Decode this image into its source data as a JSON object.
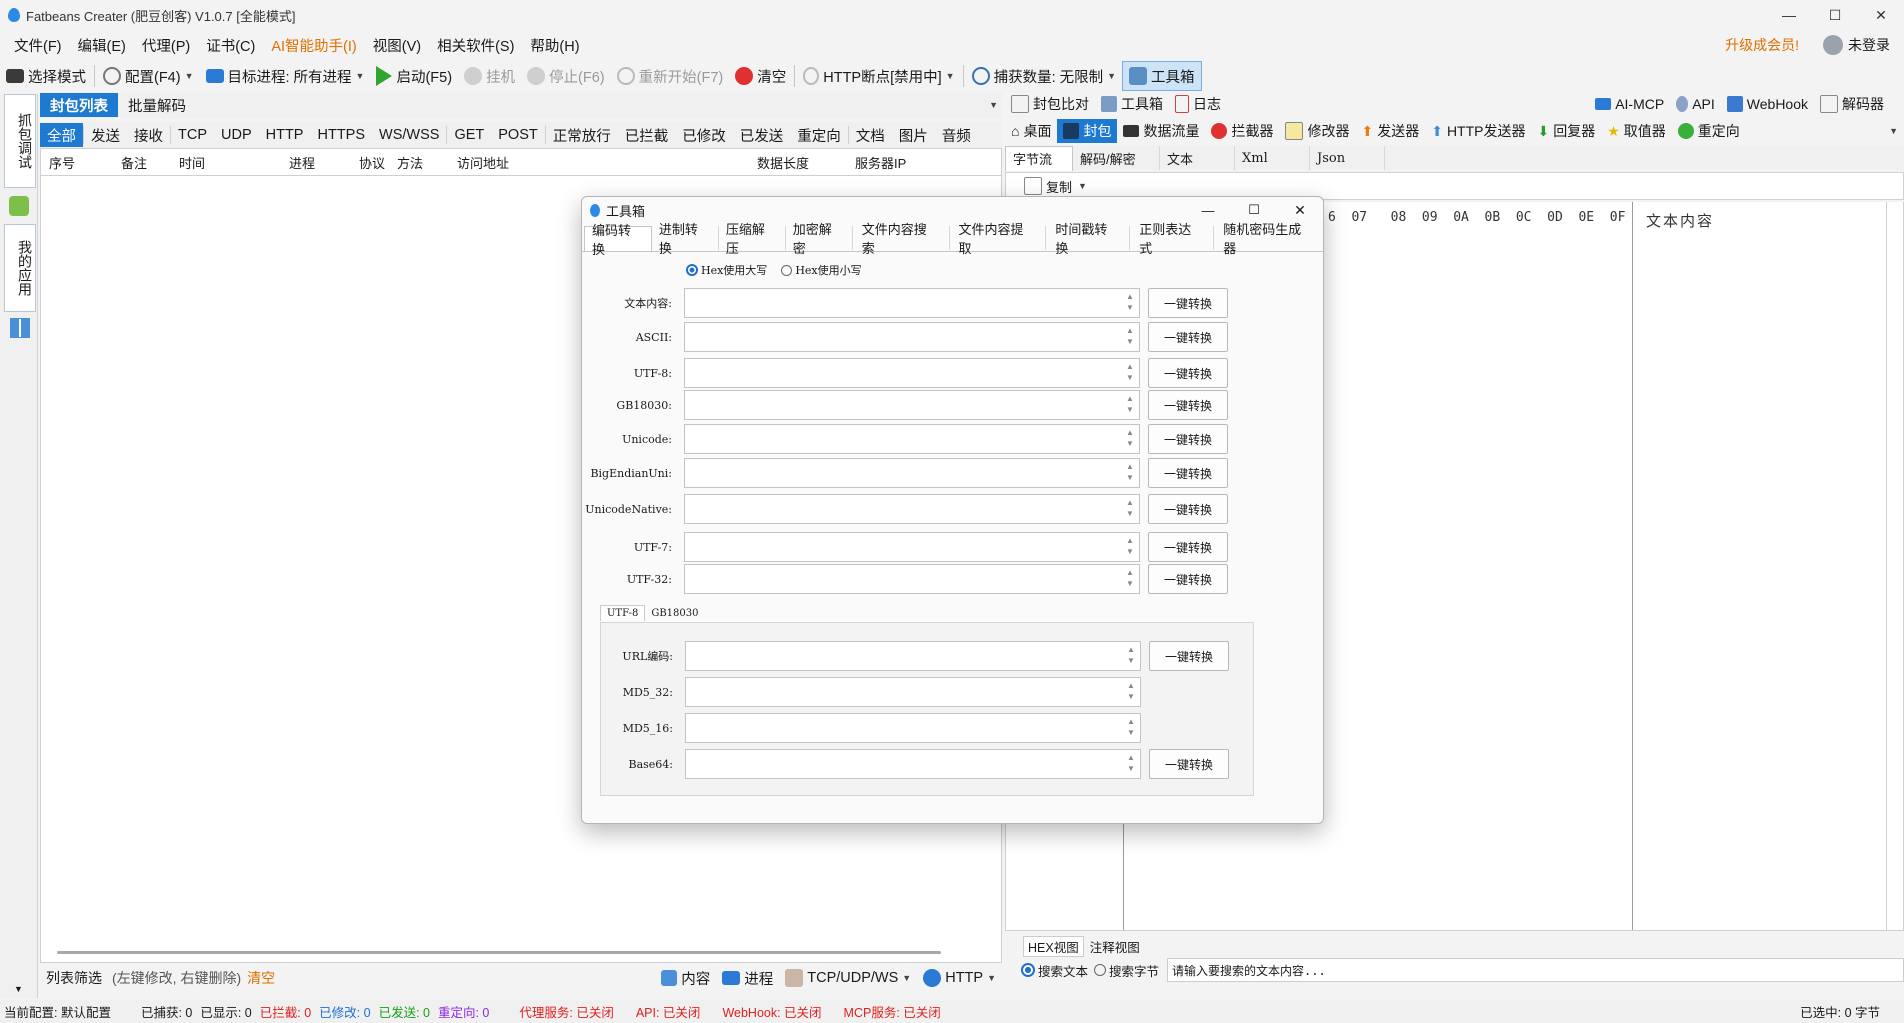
{
  "window": {
    "title": "Fatbeans Creater (肥豆创客) V1.0.7 [全能模式]",
    "min": "—",
    "max": "☐",
    "close": "✕"
  },
  "menu": [
    "文件(F)",
    "编辑(E)",
    "代理(P)",
    "证书(C)",
    "AI智能助手(I)",
    "视图(V)",
    "相关软件(S)",
    "帮助(H)"
  ],
  "menu_right": {
    "upgrade": "升级成会员!",
    "login": "未登录"
  },
  "toolbar": {
    "select_mode": "选择模式",
    "config": "配置(F4)",
    "target_label": "目标进程:",
    "target_value": "所有进程",
    "start": "启动(F5)",
    "hang": "挂机",
    "stop": "停止(F6)",
    "restart": "重新开始(F7)",
    "clear": "清空",
    "http_break": "HTTP断点[禁用中]",
    "capture_label": "捕获数量:",
    "capture_value": "无限制",
    "toolbox": "工具箱"
  },
  "leftstrip": {
    "tab1": "抓包调试",
    "tab2": "我的应用"
  },
  "left": {
    "tabs": [
      "封包列表",
      "批量解码"
    ],
    "filters": [
      "全部",
      "发送",
      "接收",
      "TCP",
      "UDP",
      "HTTP",
      "HTTPS",
      "WS/WSS",
      "GET",
      "POST",
      "正常放行",
      "已拦截",
      "已修改",
      "已发送",
      "重定向",
      "文档",
      "图片",
      "音频"
    ],
    "columns": [
      "序号",
      "备注",
      "时间",
      "进程",
      "协议",
      "方法",
      "访问地址",
      "数据长度",
      "服务器IP"
    ],
    "bottom": {
      "filter_label": "列表筛选",
      "hint": "(左键修改, 右键删除)",
      "clear": "清空",
      "content": "内容",
      "process": "进程",
      "tcp": "TCP/UDP/WS",
      "http": "HTTP"
    }
  },
  "right": {
    "row1": [
      "封包比对",
      "工具箱",
      "日志"
    ],
    "row1_right": [
      "AI-MCP",
      "API",
      "WebHook",
      "解码器"
    ],
    "row2": [
      "桌面",
      "封包",
      "数据流量",
      "拦截器",
      "修改器",
      "发送器",
      "HTTP发送器",
      "回复器",
      "取值器",
      "重定向"
    ],
    "subtabs": [
      "字节流",
      "解码/解密",
      "文本",
      "Xml",
      "Json"
    ],
    "copy": "复制",
    "hex_header": "6  07   08  09  0A  0B  0C  0D  0E  0F",
    "text_header": "文本内容",
    "view_tabs": [
      "HEX视图",
      "注释视图"
    ],
    "search_text": "搜索文本",
    "search_bytes": "搜索字节",
    "search_placeholder": "请输入要搜索的文本内容..."
  },
  "dialog": {
    "title": "工具箱",
    "tabs": [
      "编码转换",
      "进制转换",
      "压缩解压",
      "加密解密",
      "文件内容搜索",
      "文件内容提取",
      "时间戳转换",
      "正则表达式",
      "随机密码生成器"
    ],
    "hex_upper": "Hex使用大写",
    "hex_lower": "Hex使用小写",
    "fields": [
      "文本内容:",
      "ASCII:",
      "UTF-8:",
      "GB18030:",
      "Unicode:",
      "BigEndianUni:",
      "UnicodeNative:",
      "UTF-7:",
      "UTF-32:"
    ],
    "convert": "一键转换",
    "inner_tabs": [
      "UTF-8",
      "GB18030"
    ],
    "fields2": [
      "URL编码:",
      "MD5_32:",
      "MD5_16:",
      "Base64:"
    ]
  },
  "status": {
    "config": "当前配置: 默认配置",
    "captured": "已捕获: 0",
    "shown": "已显示: 0",
    "intercepted": "已拦截: 0",
    "modified": "已修改: 0",
    "sent": "已发送: 0",
    "redirect": "重定向: 0",
    "proxy": "代理服务: 已关闭",
    "api": "API: 已关闭",
    "webhook": "WebHook: 已关闭",
    "mcp": "MCP服务: 已关闭",
    "selected": "已选中: 0 字节"
  },
  "colors": {
    "accent": "#1e7ad1",
    "orange": "#e07000",
    "red": "#e02020"
  }
}
